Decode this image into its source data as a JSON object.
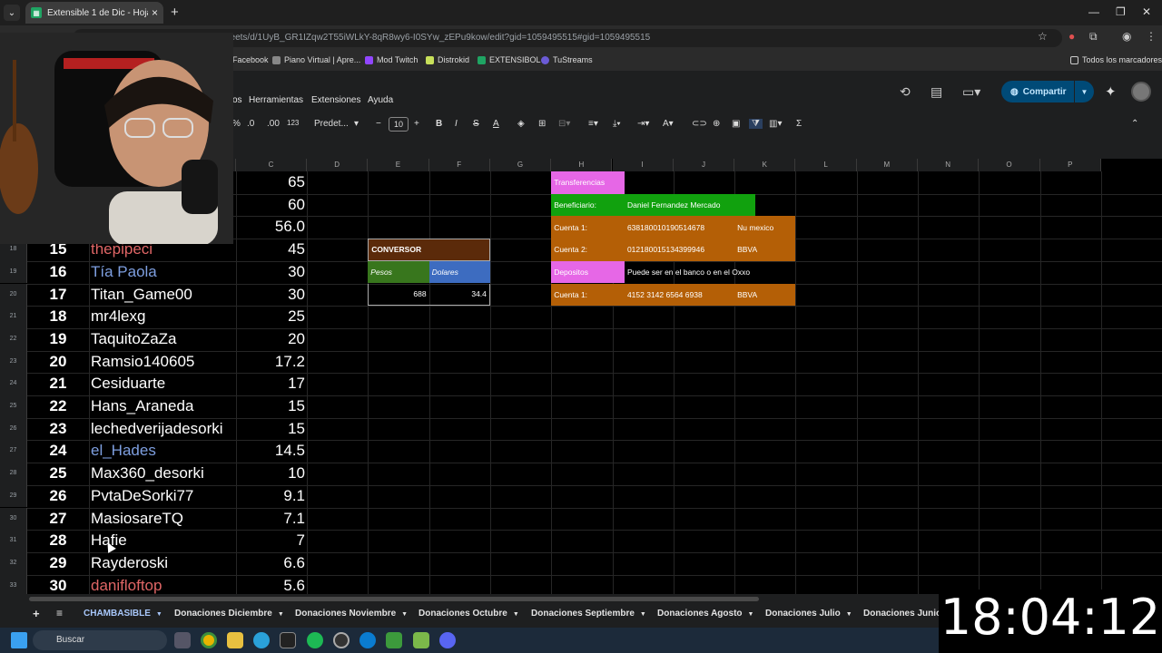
{
  "browser": {
    "tab_title": "Extensible 1 de Dic - Hojas de c",
    "tab_close": "×",
    "url": "https://docs.google.com/spreadsheets/d/1UyB_GR1IZqw2T55iWLkY-8qR8wy6-I0SYw_zEPu9kow/edit?gid=1059495515#gid=1059495515",
    "bookmarks": [
      {
        "label": "Facebook",
        "color": "#1877f2"
      },
      {
        "label": "Piano Virtual | Apre...",
        "color": "#888888"
      },
      {
        "label": "Mod Twitch",
        "color": "#9146ff"
      },
      {
        "label": "Distrokid",
        "color": "#c8e05a"
      },
      {
        "label": "EXTENSIBOL",
        "color": "#1fa463"
      },
      {
        "label": "TuStreams",
        "color": "#6b5bd6"
      }
    ],
    "all_bookmarks": "Todos los marcadores"
  },
  "sheets": {
    "menus": [
      "os",
      "Herramientas",
      "Extensiones",
      "Ayuda"
    ],
    "share_label": "Compartir",
    "toolbar": {
      "font": "Predet...",
      "font_size": "10",
      "num_format": "123",
      "decrease_decimals": ".0",
      "increase_decimals": ".00",
      "bold": "B",
      "italic": "I",
      "text_color": "A"
    }
  },
  "columns": [
    "C",
    "D",
    "E",
    "F",
    "G",
    "H",
    "I",
    "J",
    "K",
    "L",
    "M",
    "N",
    "O",
    "P"
  ],
  "rows": [
    {
      "row": "",
      "rank": "",
      "name": "",
      "amount": "65",
      "color": "#ffffff"
    },
    {
      "row": "",
      "rank": "",
      "name": "",
      "amount": "60",
      "color": "#ffffff"
    },
    {
      "row": "",
      "rank": "",
      "name": "",
      "amount": "56.0",
      "color": "#ffffff"
    },
    {
      "row": "18",
      "rank": "15",
      "name": "thepipeci",
      "amount": "45",
      "color": "#e06666"
    },
    {
      "row": "19",
      "rank": "16",
      "name": "Tía Paola",
      "amount": "30",
      "color": "#7e9fe0"
    },
    {
      "row": "20",
      "rank": "17",
      "name": "Titan_Game00",
      "amount": "30",
      "color": "#ffffff"
    },
    {
      "row": "21",
      "rank": "18",
      "name": "mr4lexg",
      "amount": "25",
      "color": "#ffffff"
    },
    {
      "row": "22",
      "rank": "19",
      "name": "TaquitoZaZa",
      "amount": "20",
      "color": "#ffffff"
    },
    {
      "row": "23",
      "rank": "20",
      "name": "Ramsio140605",
      "amount": "17.2",
      "color": "#ffffff"
    },
    {
      "row": "24",
      "rank": "21",
      "name": "Cesiduarte",
      "amount": "17",
      "color": "#ffffff"
    },
    {
      "row": "25",
      "rank": "22",
      "name": "Hans_Araneda",
      "amount": "15",
      "color": "#ffffff"
    },
    {
      "row": "26",
      "rank": "23",
      "name": "lechedverijadesorki",
      "amount": "15",
      "color": "#ffffff"
    },
    {
      "row": "27",
      "rank": "24",
      "name": "el_Hades",
      "amount": "14.5",
      "color": "#7e9fe0"
    },
    {
      "row": "28",
      "rank": "25",
      "name": "Max360_desorki",
      "amount": "10",
      "color": "#ffffff"
    },
    {
      "row": "29",
      "rank": "26",
      "name": "PvtaDeSorki77",
      "amount": "9.1",
      "color": "#ffffff"
    },
    {
      "row": "30",
      "rank": "27",
      "name": "MasiosareTQ",
      "amount": "7.1",
      "color": "#ffffff"
    },
    {
      "row": "31",
      "rank": "28",
      "name": "Hafie",
      "amount": "7",
      "color": "#ffffff"
    },
    {
      "row": "32",
      "rank": "29",
      "name": "Rayderoski",
      "amount": "6.6",
      "color": "#ffffff"
    },
    {
      "row": "33",
      "rank": "30",
      "name": "danifloftop",
      "amount": "5.6",
      "color": "#e06666"
    }
  ],
  "converter": {
    "title": "CONVERSOR",
    "pesos_label": "Pesos",
    "dolares_label": "Dolares",
    "pesos_value": "688",
    "dolares_value": "34.4"
  },
  "payment_info": {
    "transfer_label": "Transferencias",
    "beneficiary_label": "Beneficiario:",
    "beneficiary_value": "Daniel Fernandez Mercado",
    "account1_label": "Cuenta 1:",
    "account1_value": "638180010190514678",
    "account1_bank": "Nu mexico",
    "account2_label": "Cuenta 2:",
    "account2_value": "012180015134399946",
    "account2_bank": "BBVA",
    "deposits_label": "Depositos",
    "deposits_note": "Puede ser en el banco o en el Oxxo",
    "deposit_account_label": "Cuenta 1:",
    "deposit_account_value": "4152 3142 6564 6938",
    "deposit_account_bank": "BBVA"
  },
  "sheet_tabs": [
    "CHAMBASIBLE",
    "Donaciones Diciembre",
    "Donaciones Noviembre",
    "Donaciones Octubre",
    "Donaciones Septiembre",
    "Donaciones Agosto",
    "Donaciones Julio",
    "Donaciones Junio"
  ],
  "taskbar": {
    "search_placeholder": "Buscar"
  },
  "overlay": {
    "clock": "18:04:12"
  },
  "colors": {
    "transfer": "#e667e6",
    "beneficiary": "#11a10e",
    "account": "#b45f06",
    "converter_title": "#5b2a0a",
    "pesos": "#38761d",
    "dolares": "#3d6cc0"
  }
}
